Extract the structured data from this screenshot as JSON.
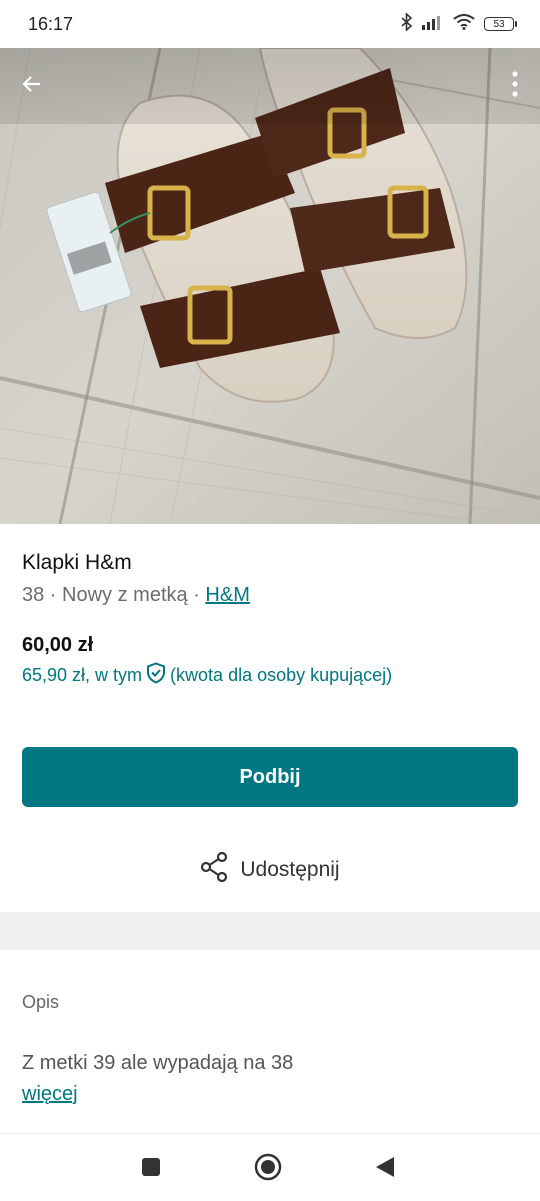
{
  "status_bar": {
    "time": "16:17",
    "battery": "53",
    "icons": [
      "bluetooth-icon",
      "signal-icon",
      "wifi-icon",
      "battery-icon"
    ]
  },
  "header": {
    "back_icon": "arrow-left-icon",
    "more_icon": "more-vertical-icon"
  },
  "product": {
    "title": "Klapki H&m",
    "size": "38",
    "separator": " · ",
    "condition": "Nowy z metką",
    "brand": "H&M",
    "price": "60,00 zł",
    "buyer_price_prefix": "65,90 zł, w tym",
    "buyer_price_note": "(kwota dla osoby kupującej)"
  },
  "actions": {
    "primary_label": "Podbij",
    "share_label": "Udostępnij"
  },
  "description": {
    "label": "Opis",
    "text": "Z metki 39 ale wypadają na 38",
    "more_label": "więcej"
  },
  "colors": {
    "accent": "#007782",
    "divider_band": "#eef0f1"
  }
}
